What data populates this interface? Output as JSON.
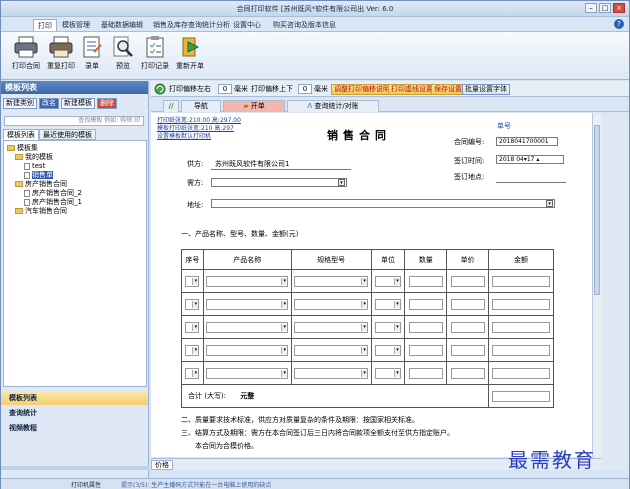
{
  "app": {
    "title": "合同打印软件 [苏州既风*软件有限公司出  Ver: 6.0"
  },
  "menu": {
    "tabs": [
      "打印",
      "模板管理",
      "基础数据编辑",
      "销售及库存查询统计分析",
      "设置中心",
      "购买咨询及版本信息"
    ],
    "active": 0
  },
  "ribbon": {
    "buttons": [
      {
        "label": "打印合同",
        "icon": "printer-icon"
      },
      {
        "label": "重复打印",
        "icon": "printer-repeat-icon"
      },
      {
        "label": "录单",
        "icon": "form-entry-icon"
      },
      {
        "label": "预览",
        "icon": "preview-magnifier-icon"
      },
      {
        "label": "打印记录",
        "icon": "print-record-icon"
      },
      {
        "label": "重新开单",
        "icon": "new-order-icon"
      }
    ]
  },
  "sidebar": {
    "title": "模板列表",
    "buttons": {
      "new_category": "新建类别",
      "rename": "改名",
      "new_template": "新建模板",
      "delete": "删除"
    },
    "search_placeholder": "查找模板 例如: 购销 印",
    "tabs": [
      "模板列表",
      "最近使用的模板"
    ],
    "tree": [
      {
        "label": "模板集",
        "level": 0,
        "type": "folder"
      },
      {
        "label": "我的模板",
        "level": 1,
        "type": "folder"
      },
      {
        "label": "test",
        "level": 2,
        "type": "doc"
      },
      {
        "label": "销售单",
        "level": 2,
        "type": "doc",
        "selected": true
      },
      {
        "label": "房产销售合同",
        "level": 1,
        "type": "folder"
      },
      {
        "label": "房产销售合同_2",
        "level": 2,
        "type": "doc"
      },
      {
        "label": "房产销售合同_1",
        "level": 2,
        "type": "doc"
      },
      {
        "label": "汽车销售合同",
        "level": 1,
        "type": "folder"
      }
    ],
    "nav": [
      "模板列表",
      "查询统计",
      "视频教程"
    ]
  },
  "toolbar2": {
    "offset_lr": "打印偏移左右",
    "offset_lr_value": "0",
    "unit1": "毫米",
    "offset_ud": "打印偏移上下",
    "offset_ud_value": "0",
    "unit2": "毫米",
    "btn_adjust": "调整打印偏移说明",
    "btn_print_line": "打印虚线设置",
    "btn_save": "保存设置",
    "btn_batch": "批量设置字体"
  },
  "doctabs": [
    "导航",
    "开单",
    "查询统计/对账"
  ],
  "doc": {
    "links": [
      "打印纸张宽:210.00 高:297.00",
      "模板打印纸张宽:210 高:297",
      "设置模板默认打印机"
    ],
    "title": "销售合同",
    "order_no_label": "单号",
    "contract_no_label": "合同编号:",
    "contract_no_value": "2018041700001",
    "sign_date_label": "签订时间:",
    "date_year": "2018",
    "date_month": "04",
    "date_day": "17",
    "sign_place_label": "签订地点:",
    "supplier_label": "供方:",
    "supplier_value": "苏州既风软件有限公司1",
    "buyer_label": "需方:",
    "address_label": "地址:",
    "section1": "一、产品名称、型号、数量、金额(元)",
    "table_headers": [
      "序号",
      "产品名称",
      "规格型号",
      "单位",
      "数量",
      "单价",
      "金额"
    ],
    "total_label": "合计 (大写):",
    "total_value": "元整",
    "clauses": [
      "二、质量要求技术标准，供应方对质量复杂的条件及期限：按国家相关标准。",
      "三、结算方式及期限：需方在本合同签订后三日内将合同款项全额支付至供方指定账户。",
      "本合同为合模价格。"
    ]
  },
  "docstatus": {
    "page_tab": "价格"
  },
  "status": {
    "left": "打印机属性",
    "hint": "提示(3/5): 生产主播码方式只能在一台电脑上使用的缺点"
  },
  "watermark": "最需教育"
}
